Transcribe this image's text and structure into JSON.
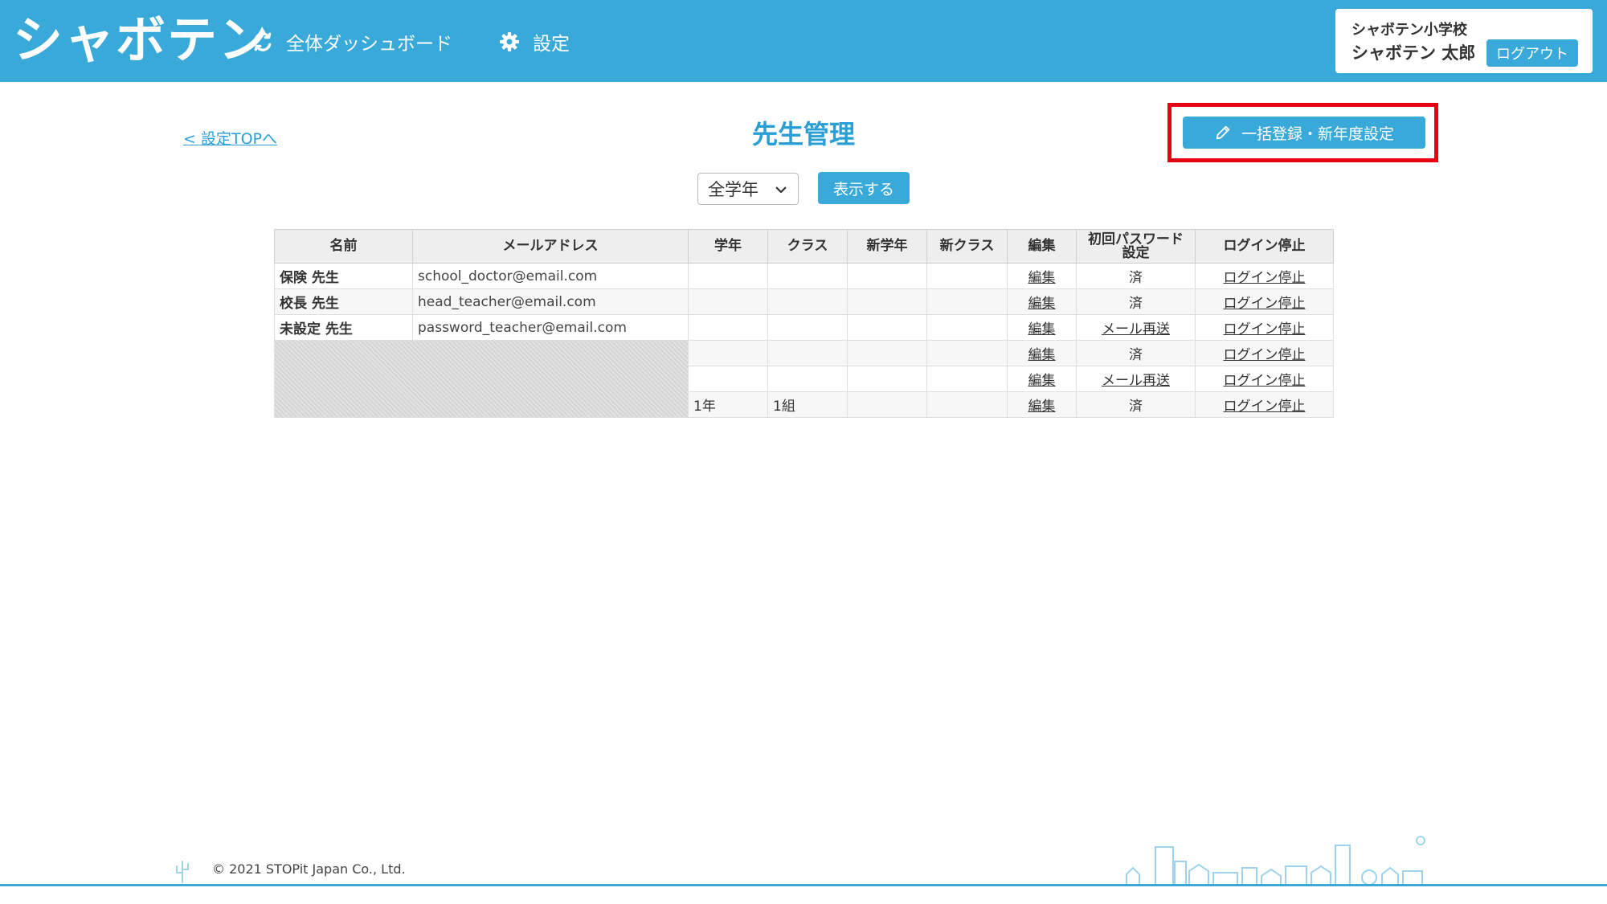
{
  "header": {
    "logo": "シャボテン",
    "nav": [
      {
        "label": "全体ダッシュボード",
        "icon": "sync-icon"
      },
      {
        "label": "設定",
        "icon": "gear-icon"
      }
    ],
    "user": {
      "school": "シャボテン小学校",
      "name": "シャボテン 太郎",
      "logout_label": "ログアウト"
    }
  },
  "main": {
    "back_link": "< 設定TOPへ",
    "title": "先生管理",
    "bulk_button": "一括登録・新年度設定",
    "filter": {
      "grade_selected": "全学年",
      "show_button": "表示する"
    }
  },
  "table": {
    "headers": [
      "名前",
      "メールアドレス",
      "学年",
      "クラス",
      "新学年",
      "新クラス",
      "編集",
      "初回パスワード設定",
      "ログイン停止"
    ],
    "password_header_lines": [
      "初回パスワード",
      "設定"
    ],
    "rows": [
      {
        "name": "保険 先生",
        "email": "school_doctor@email.com",
        "grade": "",
        "class": "",
        "new_grade": "",
        "new_class": "",
        "edit": "編集",
        "password": "済",
        "stop": "ログイン停止",
        "masked": false
      },
      {
        "name": "校長 先生",
        "email": "head_teacher@email.com",
        "grade": "",
        "class": "",
        "new_grade": "",
        "new_class": "",
        "edit": "編集",
        "password": "済",
        "stop": "ログイン停止",
        "masked": false
      },
      {
        "name": "未設定 先生",
        "email": "password_teacher@email.com",
        "grade": "",
        "class": "",
        "new_grade": "",
        "new_class": "",
        "edit": "編集",
        "password": "メール再送",
        "stop": "ログイン停止",
        "masked": false
      },
      {
        "name": "",
        "email": "",
        "grade": "",
        "class": "",
        "new_grade": "",
        "new_class": "",
        "edit": "編集",
        "password": "済",
        "stop": "ログイン停止",
        "masked": true
      },
      {
        "name": "",
        "email": "",
        "grade": "",
        "class": "",
        "new_grade": "",
        "new_class": "",
        "edit": "編集",
        "password": "メール再送",
        "stop": "ログイン停止",
        "masked": true
      },
      {
        "name": "",
        "email": "",
        "grade": "1年",
        "class": "1組",
        "new_grade": "",
        "new_class": "",
        "edit": "編集",
        "password": "済",
        "stop": "ログイン停止",
        "masked": true
      }
    ]
  },
  "footer": {
    "copyright": "© 2021 STOPit Japan Co., Ltd."
  },
  "colors": {
    "brand": "#39a9d9",
    "link": "#2a9fd6",
    "highlight": "#e60012"
  }
}
